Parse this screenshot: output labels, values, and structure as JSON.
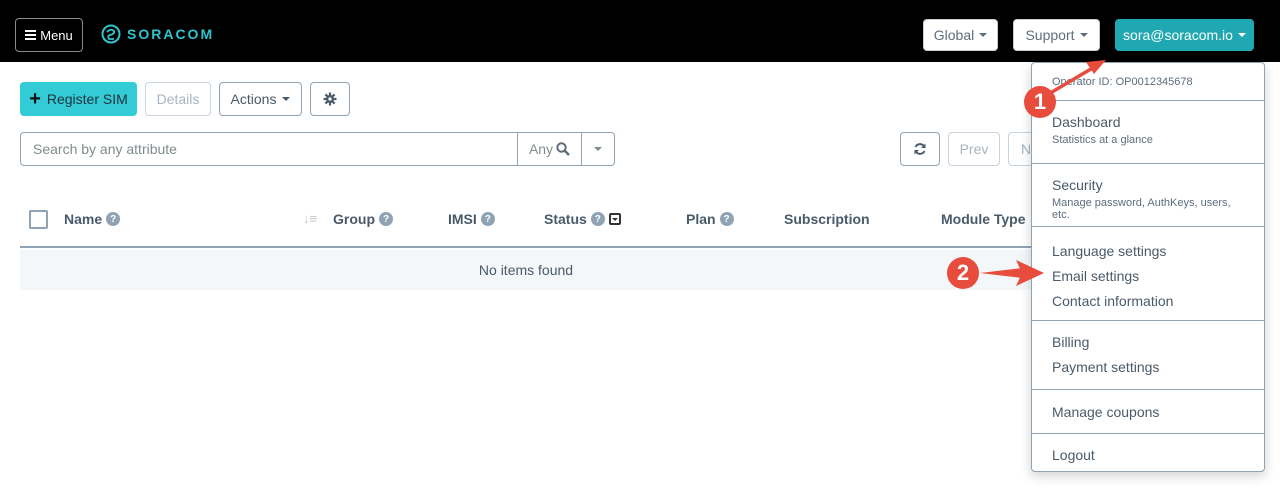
{
  "navbar": {
    "menu_label": "Menu",
    "brand": "SORACOM",
    "global_label": "Global",
    "support_label": "Support",
    "account_label": "sora@soracom.io",
    "accent_color": "#1fa8b2"
  },
  "toolbar": {
    "register_sim_label": "Register SIM",
    "details_label": "Details",
    "actions_label": "Actions"
  },
  "search": {
    "placeholder": "Search by any attribute",
    "scope_label": "Any"
  },
  "pagination": {
    "prev_label": "Prev",
    "next_label": "Next"
  },
  "table": {
    "columns": [
      "Name",
      "Group",
      "IMSI",
      "Status",
      "Plan",
      "Subscription",
      "Module Type"
    ],
    "empty_message": "No items found"
  },
  "account_menu": {
    "operator_id": "Operator ID: OP0012345678",
    "sections": [
      [
        {
          "label": "Dashboard",
          "sub": "Statistics at a glance"
        }
      ],
      [
        {
          "label": "Security",
          "sub": "Manage password, AuthKeys, users, etc."
        }
      ],
      [
        {
          "label": "Language settings"
        },
        {
          "label": "Email settings"
        },
        {
          "label": "Contact information"
        }
      ],
      [
        {
          "label": "Billing"
        },
        {
          "label": "Payment settings"
        }
      ],
      [
        {
          "label": "Manage coupons"
        }
      ],
      [
        {
          "label": "Logout"
        }
      ]
    ]
  },
  "annotations": {
    "step1": "1",
    "step2": "2",
    "color": "#e74c3c"
  }
}
